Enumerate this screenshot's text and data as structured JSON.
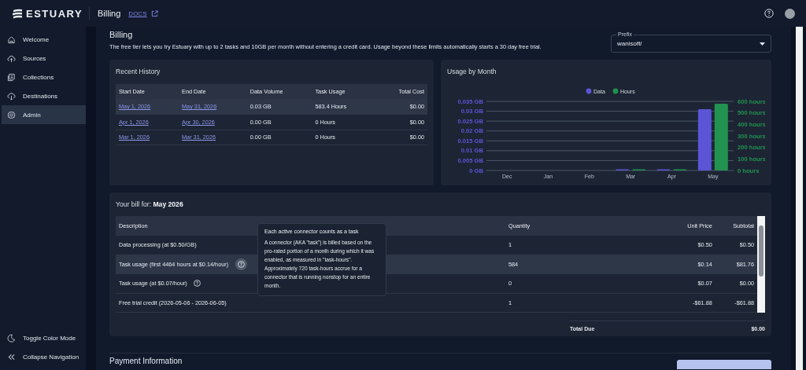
{
  "header": {
    "logo": "ESTUARY",
    "title": "Billing",
    "docs_link": "DOCS"
  },
  "sidebar": {
    "items": [
      {
        "label": "Welcome",
        "selected": false
      },
      {
        "label": "Sources",
        "selected": false
      },
      {
        "label": "Collections",
        "selected": false
      },
      {
        "label": "Destinations",
        "selected": false
      },
      {
        "label": "Admin",
        "selected": true
      }
    ],
    "footer_items": [
      {
        "label": "Toggle Color Mode"
      },
      {
        "label": "Collapse Navigation"
      }
    ]
  },
  "page": {
    "title": "Billing",
    "description": "The free tier lets you try Estuary with up to 2 tasks and 10GB per month without entering a credit card. Usage beyond these limits automatically starts a 30 day free trial.",
    "prefix": {
      "label": "Prefix",
      "value": "wanisoft/"
    }
  },
  "recent_history": {
    "title": "Recent History",
    "columns": [
      "Start Date",
      "End Date",
      "Data Volume",
      "Task Usage",
      "Total Cost"
    ],
    "rows": [
      {
        "start": "May 1, 2026",
        "end": "May 31, 2026",
        "data": "0.03 GB",
        "tasks": "583.4 Hours",
        "cost": "$0.00",
        "hovered": true
      },
      {
        "start": "Apr 1, 2026",
        "end": "Apr 30, 2026",
        "data": "0.00 GB",
        "tasks": "0 Hours",
        "cost": "$0.00",
        "hovered": false
      },
      {
        "start": "Mar 1, 2026",
        "end": "Mar 31, 2026",
        "data": "0.00 GB",
        "tasks": "0 Hours",
        "cost": "$0.00",
        "hovered": false
      }
    ]
  },
  "usage_by_month": {
    "title": "Usage by Month",
    "chart_data": {
      "type": "bar",
      "categories": [
        "Dec",
        "Jan",
        "Feb",
        "Mar",
        "Apr",
        "May"
      ],
      "series": [
        {
          "name": "Data",
          "color": "#5b55d6",
          "values": [
            null,
            null,
            null,
            0.0003,
            0.0003,
            0.031
          ]
        },
        {
          "name": "Hours",
          "color": "#21924f",
          "axis": "y2",
          "values": [
            null,
            null,
            null,
            5,
            5,
            580
          ]
        }
      ],
      "grid": true,
      "legend": "top",
      "ylim": [
        0,
        0.035
      ],
      "yticks": [
        {
          "value": 0,
          "label": "0 GB"
        },
        {
          "value": 0.005,
          "label": "0.005 GB"
        },
        {
          "value": 0.01,
          "label": "0.01 GB"
        },
        {
          "value": 0.015,
          "label": "0.015 GB"
        },
        {
          "value": 0.02,
          "label": "0.02 GB"
        },
        {
          "value": 0.025,
          "label": "0.025 GB"
        },
        {
          "value": 0.03,
          "label": "0.03 GB"
        },
        {
          "value": 0.035,
          "label": "0.035 GB"
        }
      ],
      "y2lim": [
        0,
        600
      ],
      "y2ticks": [
        {
          "value": 0,
          "label": "0 hours"
        },
        {
          "value": 100,
          "label": "100 hours"
        },
        {
          "value": 200,
          "label": "200 hours"
        },
        {
          "value": 300,
          "label": "300 hours"
        },
        {
          "value": 400,
          "label": "400 hours"
        },
        {
          "value": 500,
          "label": "500 hours"
        },
        {
          "value": 600,
          "label": "600 hours"
        }
      ]
    }
  },
  "bill": {
    "title_prefix": "Your bill for:",
    "month": "May 2026",
    "columns": [
      "Description",
      "Quantity",
      "Unit Price",
      "Subtotal"
    ],
    "rows": [
      {
        "description": "Data processing (at $0.50/GB)",
        "help": false,
        "quantity": "1",
        "unit_price": "$0.50",
        "subtotal": "$0.50",
        "hovered": false
      },
      {
        "description": "Task usage (first 4464 hours at $0.14/hour)",
        "help": true,
        "quantity": "584",
        "unit_price": "$0.14",
        "subtotal": "$81.76",
        "hovered": true
      },
      {
        "description": "Task usage (at $0.07/hour)",
        "help": true,
        "quantity": "0",
        "unit_price": "$0.07",
        "subtotal": "$0.00",
        "hovered": false
      },
      {
        "description": "Free trial credit (2026-05-06 - 2026-06-05)",
        "help": false,
        "quantity": "1",
        "unit_price": "-$61.88",
        "subtotal": "-$61.88",
        "hovered": false
      }
    ],
    "total_label": "Total Due",
    "total": "$0.00",
    "tooltip": {
      "title": "Each active connector counts as a task",
      "body": "A connector (AKA \"task\") is billed based on the pro-rated portion of a month during which it was enabled, as measured in \"task-hours\". Approximately 720 task-hours accrue for a connector that is running nonstop for an entire month."
    }
  },
  "payment": {
    "title": "Payment Information"
  }
}
